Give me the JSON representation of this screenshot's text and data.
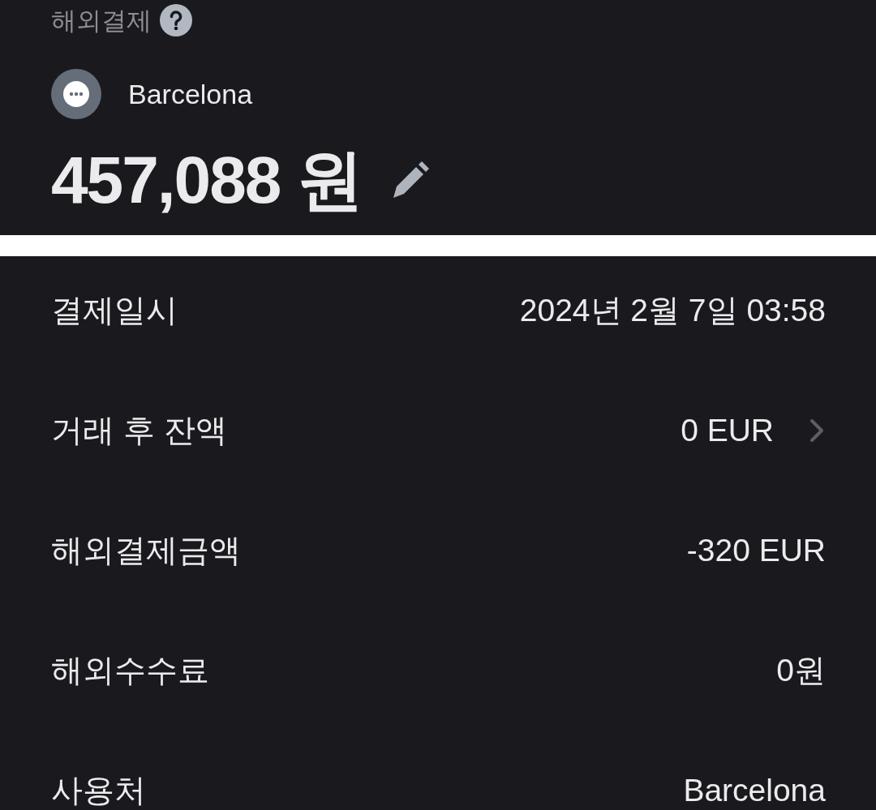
{
  "header": {
    "title": "해외결제",
    "merchant": "Barcelona",
    "amount": "457,088 원"
  },
  "details": [
    {
      "label": "결제일시",
      "value": "2024년 2월 7일 03:58",
      "kind": "plain"
    },
    {
      "label": "거래 후 잔액",
      "value": "0 EUR",
      "kind": "link"
    },
    {
      "label": "해외결제금액",
      "value": "-320 EUR",
      "kind": "plain"
    },
    {
      "label": "해외수수료",
      "value": "0원",
      "kind": "plain"
    },
    {
      "label": "사용처",
      "value": "Barcelona",
      "kind": "plain"
    }
  ]
}
